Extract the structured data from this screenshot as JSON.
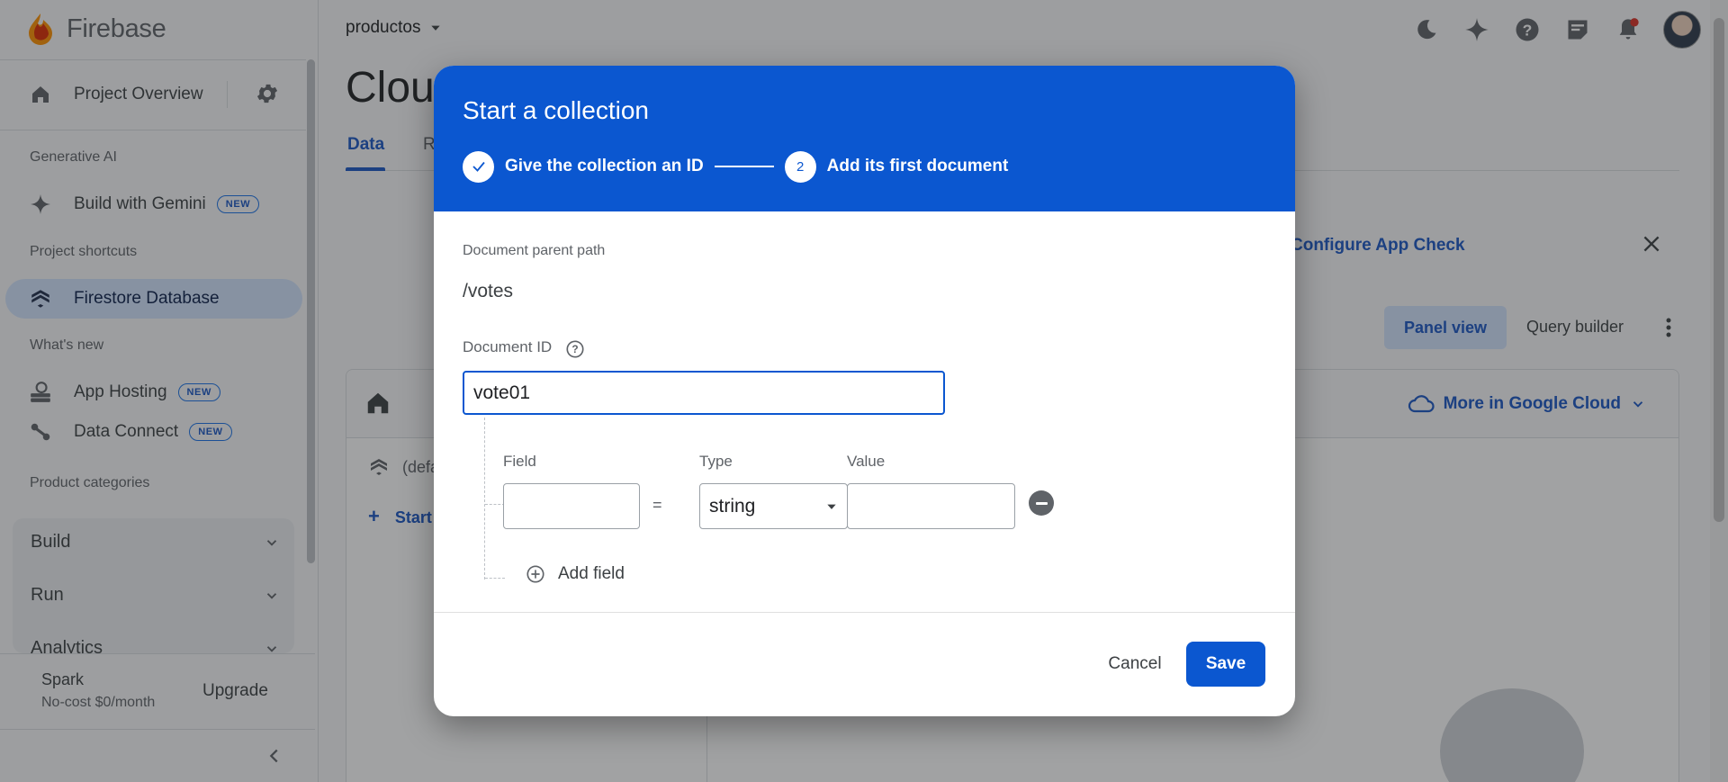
{
  "brand": {
    "name": "Firebase"
  },
  "sidebar": {
    "project_overview": "Project Overview",
    "sections": {
      "generative_ai": "Generative AI",
      "project_shortcuts": "Project shortcuts",
      "whats_new": "What's new",
      "product_categories": "Product categories"
    },
    "build_with_gemini": "Build with Gemini",
    "firestore": "Firestore Database",
    "app_hosting": "App Hosting",
    "data_connect": "Data Connect",
    "new_badge": "NEW",
    "categories": [
      "Build",
      "Run",
      "Analytics"
    ],
    "plan": {
      "name": "Spark",
      "price": "No-cost $0/month",
      "upgrade": "Upgrade"
    }
  },
  "topbar": {
    "project": "productos",
    "icons": [
      "dark-mode-icon",
      "gemini-icon",
      "help-icon",
      "feedback-icon",
      "notifications-icon"
    ]
  },
  "main": {
    "title": "Cloud Firestore",
    "tabs": [
      "Data",
      "Rules"
    ],
    "banner_link": "Configure App Check",
    "panel_view": "Panel view",
    "query_builder": "Query builder",
    "more_cloud": "More in Google Cloud",
    "default_db": "(default)",
    "start_collection": "Start collection"
  },
  "dialog": {
    "title": "Start a collection",
    "steps": [
      {
        "label": "Give the collection an ID",
        "status": "done"
      },
      {
        "number": "2",
        "label": "Add its first document",
        "status": "active"
      }
    ],
    "parent_path_label": "Document parent path",
    "parent_path": "/votes",
    "doc_id_label": "Document ID",
    "doc_id_value": "vote01",
    "field_headers": {
      "field": "Field",
      "type": "Type",
      "value": "Value"
    },
    "field_row": {
      "field": "",
      "type": "string",
      "value": ""
    },
    "equals": "=",
    "add_field": "Add field",
    "cancel": "Cancel",
    "save": "Save"
  },
  "colors": {
    "accent": "#0b57d0",
    "active_nav_bg": "#d3e3fd",
    "link": "#1a56c4"
  }
}
